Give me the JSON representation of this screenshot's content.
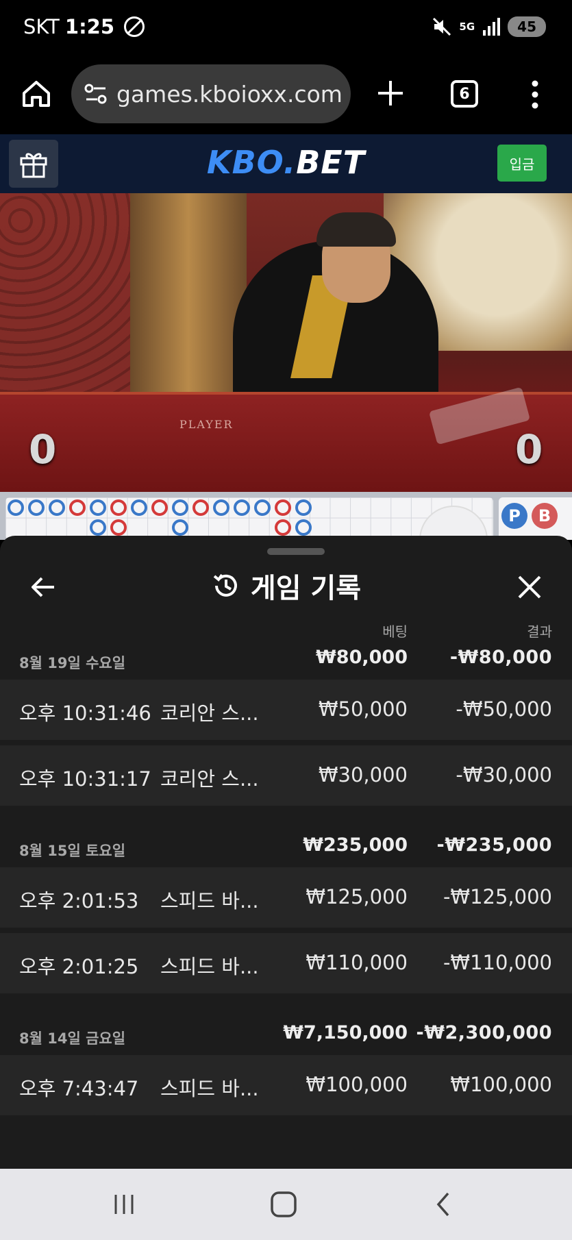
{
  "status_bar": {
    "carrier": "SKT",
    "time": "1:25",
    "network": "5G",
    "battery": "45"
  },
  "browser": {
    "url": "games.kboioxx.com/",
    "tab_count": "6"
  },
  "site": {
    "logo_part1": "KBO.",
    "logo_part2": "BET",
    "deposit_label": "입금"
  },
  "video": {
    "table_label": "PLAYER",
    "score_left": "0",
    "score_right": "0"
  },
  "roadmap": {
    "player_label": "P",
    "banker_label": "B"
  },
  "history": {
    "title": "게임 기록",
    "col_bet": "베팅",
    "col_result": "결과",
    "groups": [
      {
        "date": "8월 19일 수요일",
        "total_bet": "₩80,000",
        "total_result": "-₩80,000",
        "entries": [
          {
            "time": "오후 10:31:46",
            "game": "코리안 스...",
            "bet": "₩50,000",
            "result": "-₩50,000"
          },
          {
            "time": "오후 10:31:17",
            "game": "코리안 스...",
            "bet": "₩30,000",
            "result": "-₩30,000"
          }
        ]
      },
      {
        "date": "8월 15일 토요일",
        "total_bet": "₩235,000",
        "total_result": "-₩235,000",
        "entries": [
          {
            "time": "오후 2:01:53",
            "game": "스피드 바...",
            "bet": "₩125,000",
            "result": "-₩125,000"
          },
          {
            "time": "오후 2:01:25",
            "game": "스피드 바...",
            "bet": "₩110,000",
            "result": "-₩110,000"
          }
        ]
      },
      {
        "date": "8월 14일 금요일",
        "total_bet": "₩7,150,000",
        "total_result": "-₩2,300,000",
        "entries": [
          {
            "time": "오후 7:43:47",
            "game": "스피드 바...",
            "bet": "₩100,000",
            "result": "₩100,000"
          }
        ]
      }
    ]
  },
  "colors": {
    "header_bg": "#0d1a33",
    "logo_blue": "#3d8df5",
    "deposit_green": "#2aa84a",
    "sheet_bg": "#1c1c1c",
    "row_bg": "#262626"
  },
  "icons": [
    "home-icon",
    "site-settings-icon",
    "add-tab-icon",
    "more-icon",
    "gift-icon",
    "back-arrow-icon",
    "history-icon",
    "close-icon",
    "recents-icon",
    "home-nav-icon",
    "back-nav-icon"
  ]
}
